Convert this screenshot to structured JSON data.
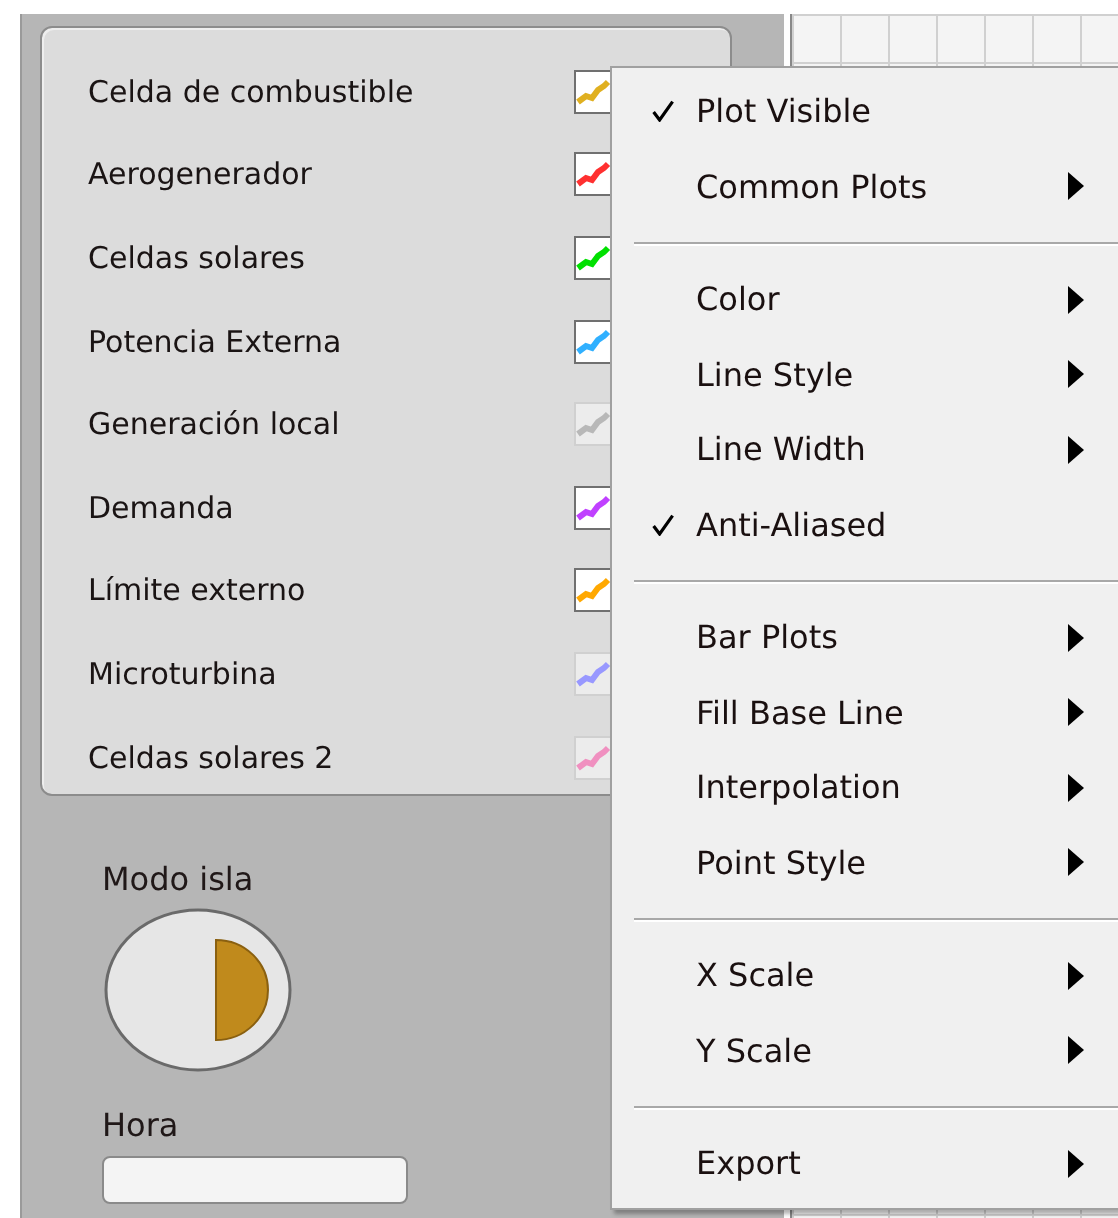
{
  "legend": {
    "items": [
      {
        "label": "Celda de combustible",
        "color": "#e0b020",
        "dimmed": false
      },
      {
        "label": "Aerogenerador",
        "color": "#ff3030",
        "dimmed": false
      },
      {
        "label": "Celdas solares",
        "color": "#00e000",
        "dimmed": false
      },
      {
        "label": "Potencia Externa",
        "color": "#30b0ff",
        "dimmed": false
      },
      {
        "label": "Generación local",
        "color": "#b8b8b8",
        "dimmed": true
      },
      {
        "label": "Demanda",
        "color": "#c040ff",
        "dimmed": false
      },
      {
        "label": "Límite externo",
        "color": "#ffa800",
        "dimmed": false
      },
      {
        "label": "Microturbina",
        "color": "#9898ff",
        "dimmed": true
      },
      {
        "label": "Celdas solares 2",
        "color": "#f090c0",
        "dimmed": true
      }
    ]
  },
  "island_mode": {
    "label": "Modo isla",
    "on": true
  },
  "time": {
    "label": "Hora"
  },
  "context_menu": {
    "items": [
      {
        "kind": "item",
        "label": "Plot Visible",
        "checked": true,
        "submenu": false
      },
      {
        "kind": "item",
        "label": "Common Plots",
        "checked": false,
        "submenu": true
      },
      {
        "kind": "separator"
      },
      {
        "kind": "item",
        "label": "Color",
        "checked": false,
        "submenu": true
      },
      {
        "kind": "item",
        "label": "Line Style",
        "checked": false,
        "submenu": true
      },
      {
        "kind": "item",
        "label": "Line Width",
        "checked": false,
        "submenu": true
      },
      {
        "kind": "item",
        "label": "Anti-Aliased",
        "checked": true,
        "submenu": false
      },
      {
        "kind": "separator"
      },
      {
        "kind": "item",
        "label": "Bar Plots",
        "checked": false,
        "submenu": true
      },
      {
        "kind": "item",
        "label": "Fill Base Line",
        "checked": false,
        "submenu": true
      },
      {
        "kind": "item",
        "label": "Interpolation",
        "checked": false,
        "submenu": true
      },
      {
        "kind": "item",
        "label": "Point Style",
        "checked": false,
        "submenu": true
      },
      {
        "kind": "separator"
      },
      {
        "kind": "item",
        "label": "X Scale",
        "checked": false,
        "submenu": true
      },
      {
        "kind": "item",
        "label": "Y Scale",
        "checked": false,
        "submenu": true
      },
      {
        "kind": "separator"
      },
      {
        "kind": "item",
        "label": "Export",
        "checked": false,
        "submenu": true
      }
    ]
  }
}
